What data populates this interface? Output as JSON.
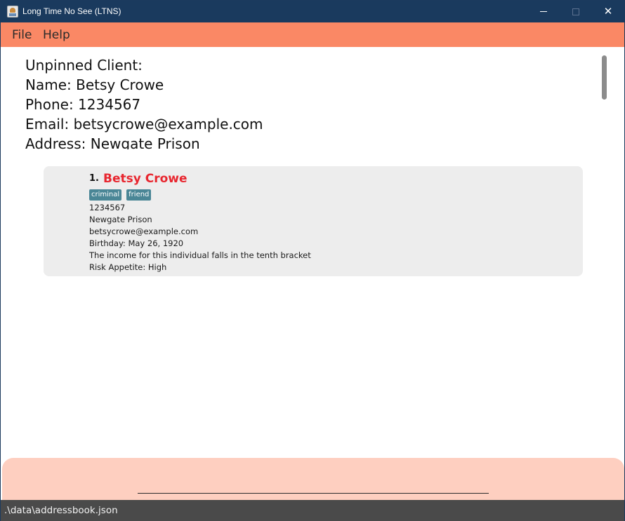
{
  "window": {
    "title": "Long Time No See (LTNS)",
    "minimize_icon": "minimize-icon",
    "maximize_icon": "maximize-icon",
    "close_symbol": "✕"
  },
  "menu": {
    "file": "File",
    "help": "Help"
  },
  "detail": {
    "line1": "Unpinned Client:",
    "line2": "Name: Betsy Crowe",
    "line3": "Phone: 1234567",
    "line4": "Email: betsycrowe@example.com",
    "line5": "Address: Newgate Prison"
  },
  "client_list": [
    {
      "index": "1.",
      "name": "Betsy Crowe",
      "tags": [
        "criminal",
        "friend"
      ],
      "phone": "1234567",
      "address": "Newgate Prison",
      "email": "betsycrowe@example.com",
      "birthday": "Birthday: May 26, 1920",
      "income": "The income for this individual falls in the tenth bracket",
      "risk": "Risk Appetite: High"
    }
  ],
  "command": {
    "value": ""
  },
  "status": {
    "file_path": ".\\data\\addressbook.json"
  },
  "colors": {
    "title_bar": "#1a3a5e",
    "menu_bar": "#fa8865",
    "command_area": "#fecfc0",
    "status_bar": "#4a4a4a",
    "client_name": "#e8262f",
    "tag": "#4a8696",
    "card": "#ededed"
  }
}
